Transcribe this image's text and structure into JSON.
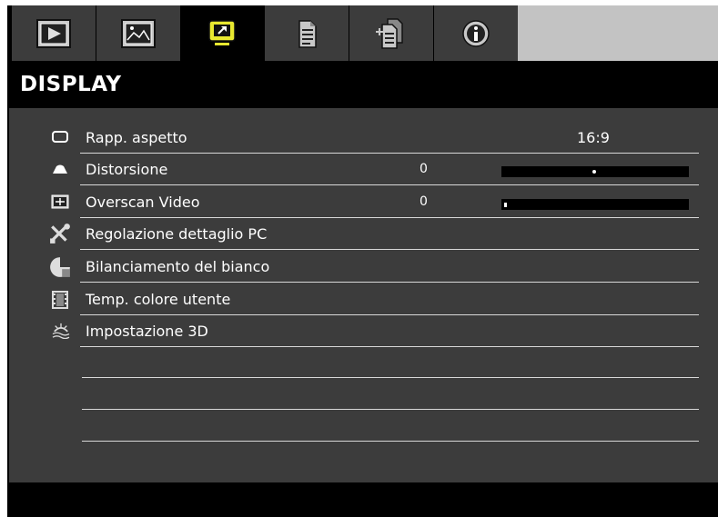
{
  "tabs": [
    {
      "name": "image-tab",
      "icon": "play-screen-icon"
    },
    {
      "name": "picture-tab",
      "icon": "picture-icon"
    },
    {
      "name": "display-tab",
      "icon": "display-icon",
      "active": true
    },
    {
      "name": "setup-tab",
      "icon": "document-icon"
    },
    {
      "name": "options-tab",
      "icon": "documents-icon"
    },
    {
      "name": "info-tab",
      "icon": "info-icon"
    }
  ],
  "header": {
    "title": "DISPLAY"
  },
  "menu": {
    "items": [
      {
        "label": "Rapp. aspetto",
        "icon": "aspect-ratio-icon",
        "value": "16:9"
      },
      {
        "label": "Distorsione",
        "icon": "keystone-icon",
        "number": "0",
        "slider_fraction": 0.5
      },
      {
        "label": "Overscan Video",
        "icon": "overscan-icon",
        "number": "0",
        "slider_fraction": 0.0
      },
      {
        "label": "Regolazione dettaglio PC",
        "icon": "tools-icon"
      },
      {
        "label": "Bilanciamento del bianco",
        "icon": "white-balance-icon"
      },
      {
        "label": "Temp. colore utente",
        "icon": "film-icon"
      },
      {
        "label": "Impostazione 3D",
        "icon": "3d-setting-icon"
      }
    ]
  },
  "colors": {
    "panel": "#3c3c3c",
    "header": "#000000",
    "tab_inactive": "#3c3c3c",
    "tab_empty": "#c3c3c3",
    "text": "#ffffff",
    "separator": "#d8d8d8"
  }
}
